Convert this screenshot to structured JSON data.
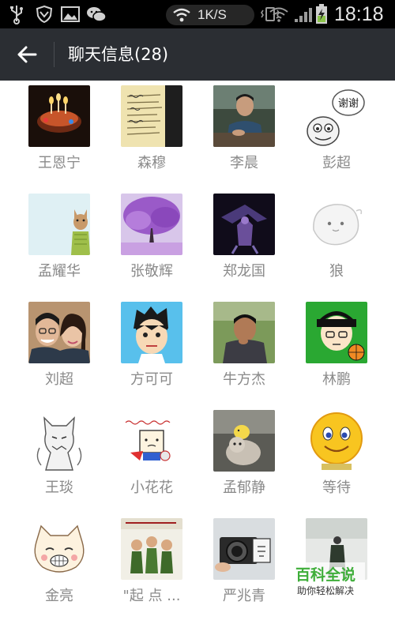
{
  "status_bar": {
    "net_speed": "1K/S",
    "time": "18:18",
    "icons": [
      "usb-icon",
      "shield-icon",
      "image-icon",
      "wechat-icon",
      "wifi-icon",
      "vibrate-icon",
      "wifi-signal-icon",
      "cell-signal-icon",
      "battery-charging-icon"
    ]
  },
  "header": {
    "title": "聊天信息(28)",
    "back_icon": "arrow-left-icon",
    "background": "#2b2e33"
  },
  "members": [
    {
      "name": "王恩宁",
      "avatar": "birthday-candles"
    },
    {
      "name": "森穆",
      "avatar": "handwritten-note"
    },
    {
      "name": "李晨",
      "avatar": "man-at-table"
    },
    {
      "name": "彭超",
      "avatar": "cartoon-xiexie"
    },
    {
      "name": "孟耀华",
      "avatar": "cat-in-shirt"
    },
    {
      "name": "张敬辉",
      "avatar": "purple-tree"
    },
    {
      "name": "郑龙国",
      "avatar": "dark-warrior"
    },
    {
      "name": "狼",
      "avatar": "white-blob"
    },
    {
      "name": "刘超",
      "avatar": "couple-selfie"
    },
    {
      "name": "方可可",
      "avatar": "cartoon-boy"
    },
    {
      "name": "牛方杰",
      "avatar": "man-outdoors"
    },
    {
      "name": "林鹏",
      "avatar": "cartoon-basketball"
    },
    {
      "name": "王琰",
      "avatar": "werewolf-sketch"
    },
    {
      "name": "小花花",
      "avatar": "cartoon-box-hero"
    },
    {
      "name": "孟郁静",
      "avatar": "kitten-chick"
    },
    {
      "name": "等待",
      "avatar": "yellow-smiley"
    },
    {
      "name": "金亮",
      "avatar": "cartoon-cat-face"
    },
    {
      "name": "\"起 点 ...",
      "avatar": "soldiers-poster"
    },
    {
      "name": "严兆青",
      "avatar": "vintage-camera"
    },
    {
      "name": "",
      "avatar": "soldier-grey"
    }
  ],
  "watermark": {
    "main": "百科全说",
    "sub": "助你轻松解决"
  }
}
